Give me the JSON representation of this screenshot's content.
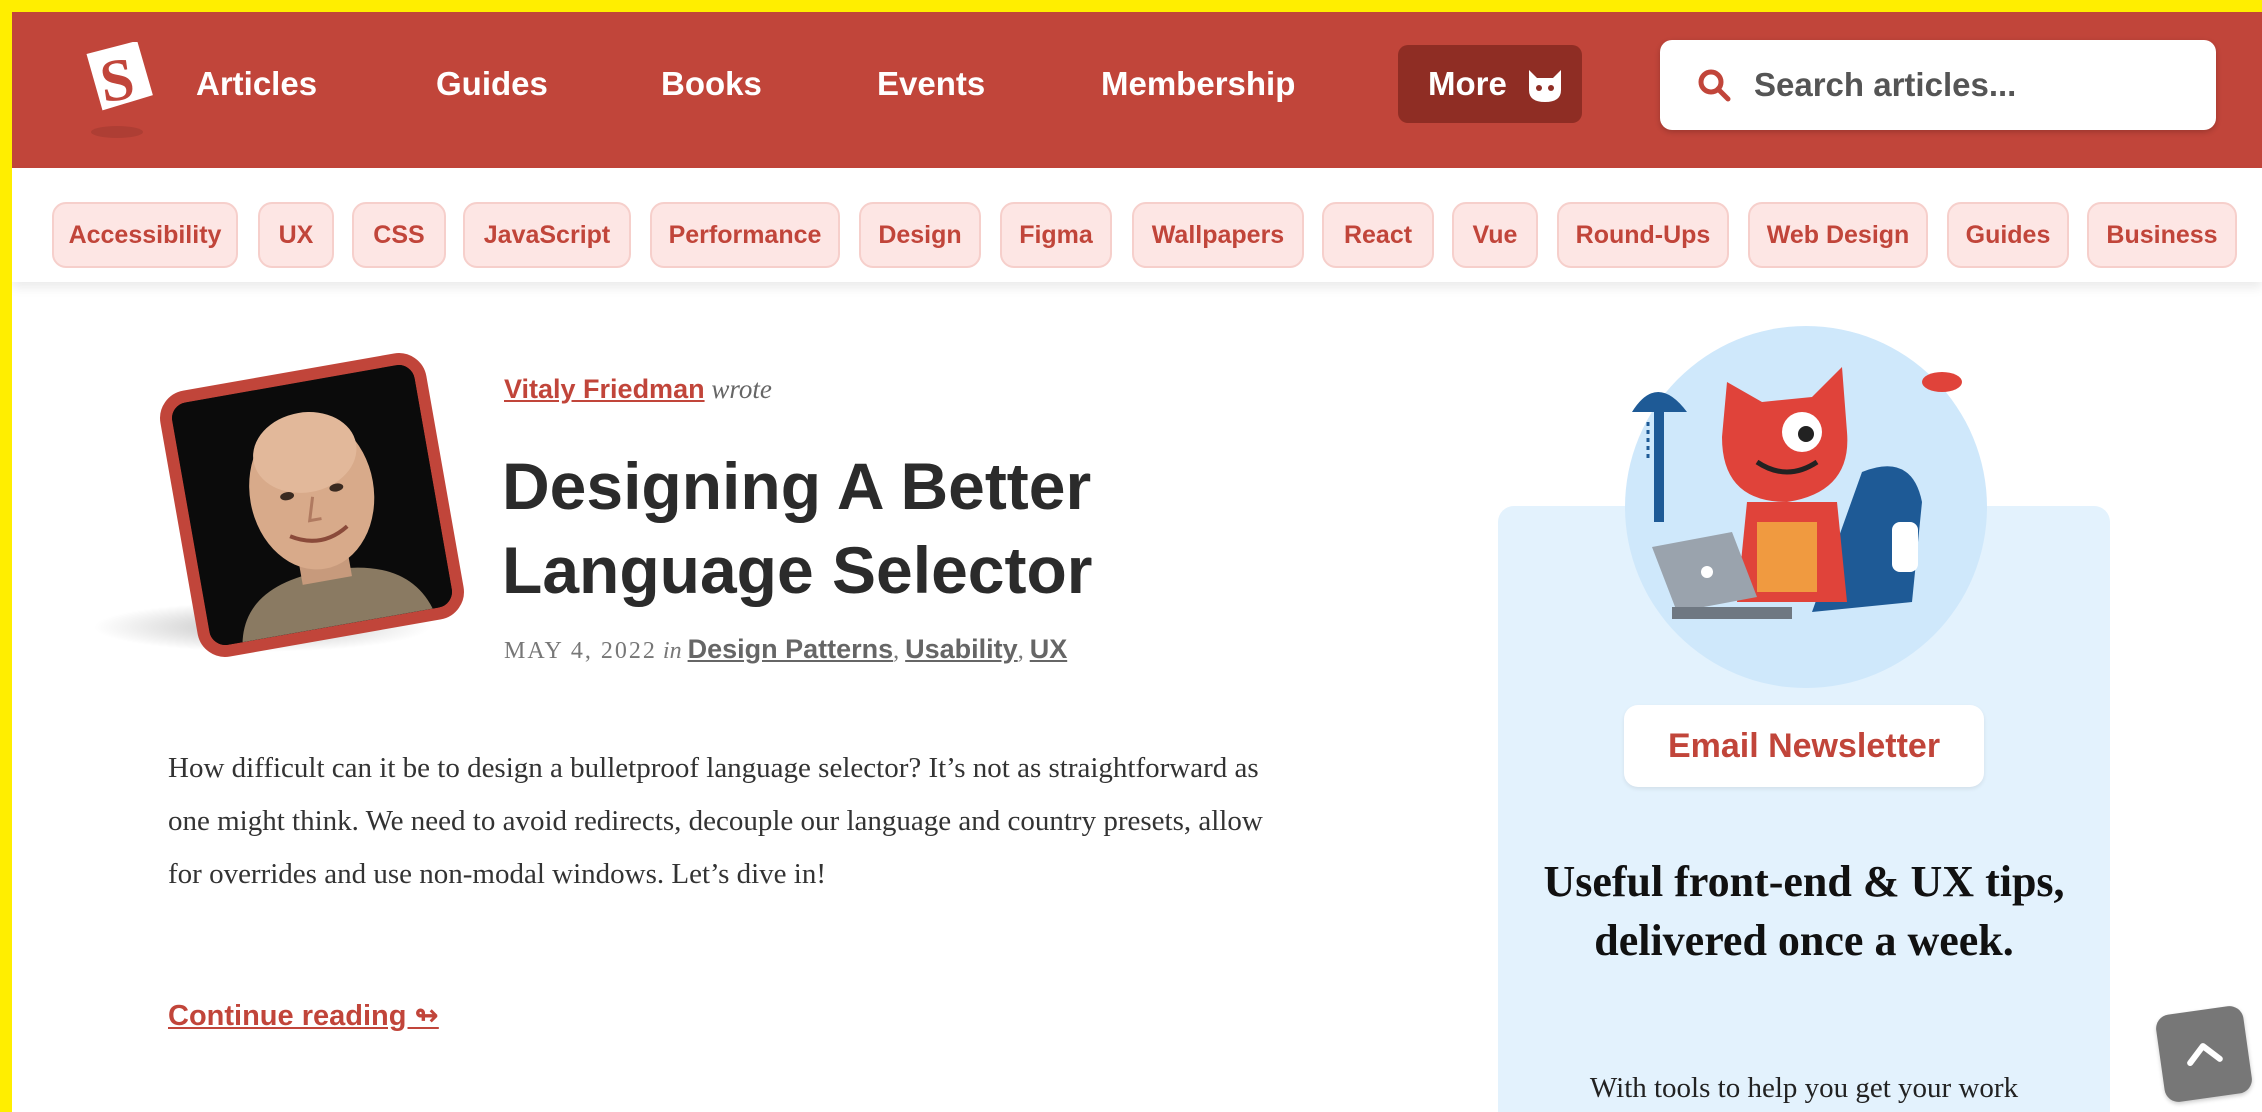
{
  "header": {
    "nav": [
      "Articles",
      "Guides",
      "Books",
      "Events",
      "Membership"
    ],
    "more_label": "More",
    "search_placeholder": "Search articles..."
  },
  "tags": [
    "Accessibility",
    "UX",
    "CSS",
    "JavaScript",
    "Performance",
    "Design",
    "Figma",
    "Wallpapers",
    "React",
    "Vue",
    "Round-Ups",
    "Web Design",
    "Guides",
    "Business"
  ],
  "article": {
    "author": "Vitaly Friedman",
    "wrote": "wrote",
    "title": "Designing A Better Language Selector",
    "date": "MAY 4, 2022",
    "in": "in",
    "categories": [
      "Design Patterns",
      "Usability",
      "UX"
    ],
    "excerpt": "How difficult can it be to design a bulletproof language selector? It’s not as straightforward as one might think. We need to avoid redirects, decouple our language and country presets, allow for overrides and use non-modal windows. Let’s dive in!",
    "continue_label": "Continue reading ↬"
  },
  "newsletter": {
    "badge": "Email Newsletter",
    "heading": "Useful front-end & UX tips, delivered once a week.",
    "text": "With tools to help you get your work"
  },
  "icons": {
    "logo": "smashing-logo",
    "more": "cat-icon",
    "search": "search-icon",
    "back_to_top": "chevron-up-icon"
  },
  "colors": {
    "brand": "#c1453a",
    "brand_dark": "#8f2d24",
    "tag_bg": "#fde6e4",
    "newsletter_bg": "#e3f2fd",
    "frame": "#ffee00"
  }
}
